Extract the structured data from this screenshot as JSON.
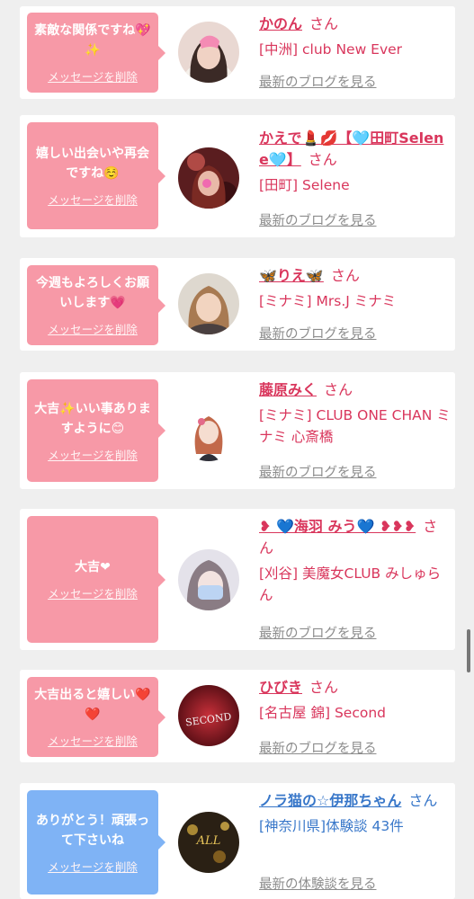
{
  "colors": {
    "pink_bubble": "#f799a7",
    "blue_bubble": "#7fb3f5",
    "name_pink": "#d9365c",
    "name_blue": "#3877c9",
    "link_gray": "#8c8c8c"
  },
  "cards": [
    {
      "message": "素敵な関係ですね💖✨",
      "delete_label": "メッセージを削除",
      "avatar_icon": "profile-photo",
      "name": "かのん",
      "honorific": "さん",
      "shop": "[中洲] club New Ever",
      "link": "最新のブログを見る"
    },
    {
      "message": "嬉しい出会いや再会ですね☺️",
      "delete_label": "メッセージを削除",
      "avatar_icon": "profile-photo",
      "name": "かえで💄💋【🩵田町Selene🩵】",
      "honorific": "さん",
      "shop": "[田町] Selene",
      "link": "最新のブログを見る"
    },
    {
      "message": "今週もよろしくお願いします💗",
      "delete_label": "メッセージを削除",
      "avatar_icon": "profile-photo",
      "name": "🦋りえ🦋",
      "honorific": "さん",
      "shop": "[ミナミ] Mrs.J ミナミ",
      "link": "最新のブログを見る"
    },
    {
      "message": "大吉✨いい事ありますように😊",
      "delete_label": "メッセージを削除",
      "avatar_icon": "profile-photo",
      "name": "藤原みく",
      "honorific": "さん",
      "shop": "[ミナミ] CLUB ONE CHAN ミナミ 心斎橋",
      "link": "最新のブログを見る"
    },
    {
      "message": "大吉❤",
      "delete_label": "メッセージを削除",
      "avatar_icon": "profile-photo",
      "name": "❥ 💙海羽 みう💙 ❥❥❥",
      "honorific": "さん",
      "shop": "[刈谷] 美魔女CLUB みしゅらん",
      "link": "最新のブログを見る"
    },
    {
      "message": "大吉出ると嬉しい❤️❤️",
      "delete_label": "メッセージを削除",
      "avatar_icon": "profile-photo",
      "name": "ひびき",
      "honorific": "さん",
      "shop": "[名古屋 錦] Second",
      "avatar_text": "SECOND",
      "link": "最新のブログを見る"
    },
    {
      "message": "ありがとう！頑張って下さいね",
      "delete_label": "メッセージを削除",
      "avatar_icon": "profile-photo",
      "name": "ノラ猫の☆伊那ちゃん",
      "honorific": "さん",
      "shop": "[神奈川県]体験談 43件",
      "avatar_text": "ALL",
      "link": "最新の体験談を見る"
    }
  ]
}
